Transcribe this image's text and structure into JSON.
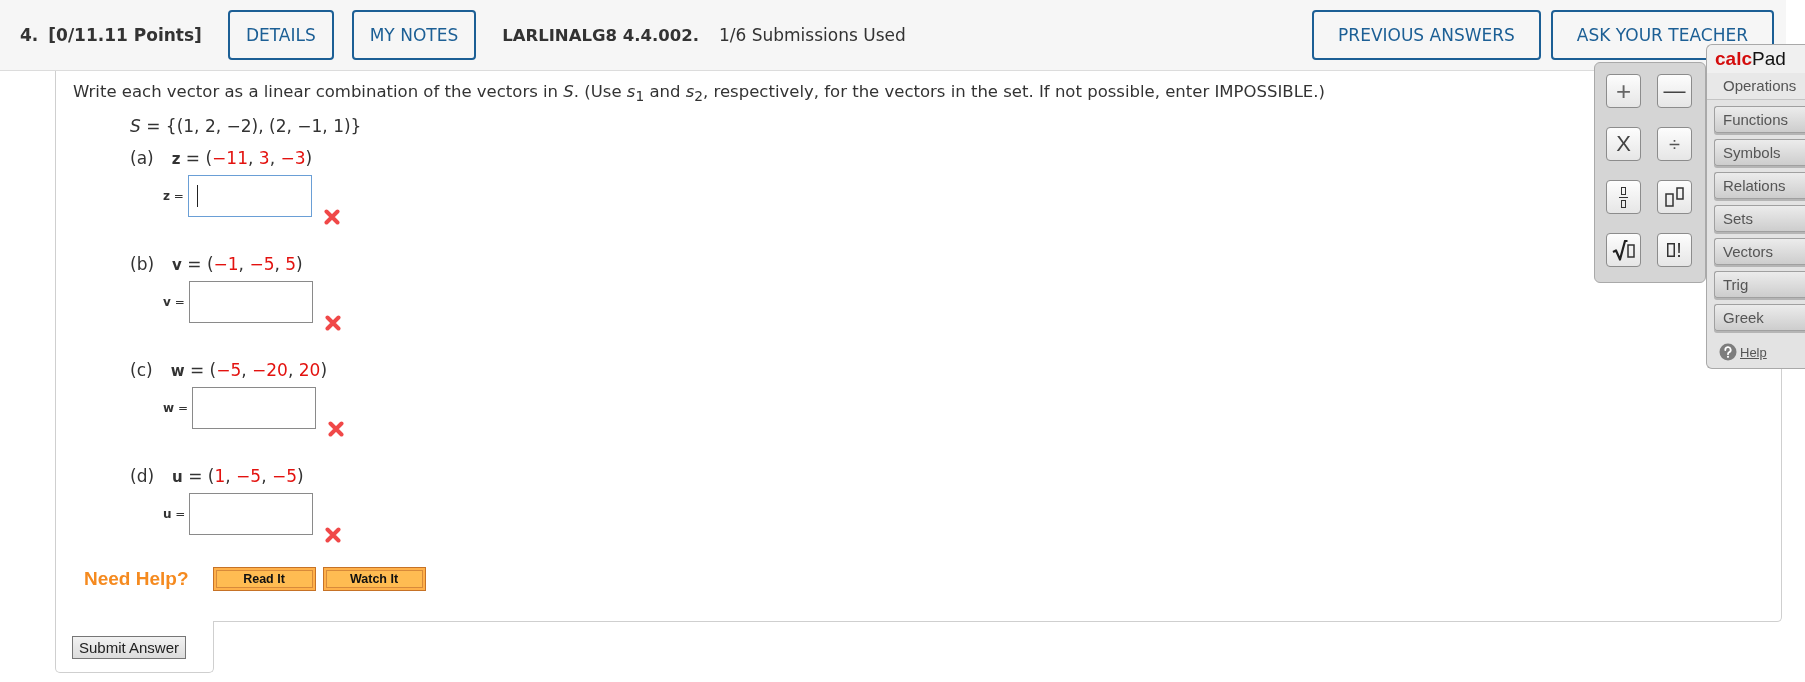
{
  "header": {
    "number": "4.",
    "points": "[0/11.11 Points]",
    "buttons_left": [
      {
        "label": "DETAILS"
      },
      {
        "label": "MY NOTES"
      }
    ],
    "code": "LARLINALG8 4.4.002.",
    "submissions": "1/6 Submissions Used",
    "buttons_right": [
      {
        "label": "PREVIOUS ANSWERS"
      },
      {
        "label": "ASK YOUR TEACHER"
      }
    ]
  },
  "question": {
    "instruction": "Write each vector as a linear combination of the vectors in *S*. (Use *s*$_{1}$ and *s*$_{2}$, respectively, for the vectors in the set. If not possible, enter IMPOSSIBLE.)",
    "set": "*S* = {(1, 2, −2), (2, −1, 1)}",
    "parts": [
      {
        "label": "(a)",
        "given": [
          {
            "kind": "name",
            "text": "z"
          },
          {
            "kind": "plain",
            "text": " = ("
          },
          {
            "kind": "value",
            "text": "−11"
          },
          {
            "kind": "plain",
            "text": ", "
          },
          {
            "kind": "value",
            "text": "3"
          },
          {
            "kind": "plain",
            "text": ", "
          },
          {
            "kind": "value",
            "text": "−3"
          },
          {
            "kind": "plain",
            "text": ")"
          }
        ],
        "answer_label": "**z** =",
        "focused": true,
        "correct": false
      },
      {
        "label": "(b)",
        "given": [
          {
            "kind": "name",
            "text": "v"
          },
          {
            "kind": "plain",
            "text": " = ("
          },
          {
            "kind": "value",
            "text": "−1"
          },
          {
            "kind": "plain",
            "text": ", "
          },
          {
            "kind": "value",
            "text": "−5"
          },
          {
            "kind": "plain",
            "text": ", "
          },
          {
            "kind": "value",
            "text": "5"
          },
          {
            "kind": "plain",
            "text": ")"
          }
        ],
        "answer_label": "**v** =",
        "focused": false,
        "correct": false
      },
      {
        "label": "(c)",
        "given": [
          {
            "kind": "name",
            "text": "w"
          },
          {
            "kind": "plain",
            "text": " = ("
          },
          {
            "kind": "value",
            "text": "−5"
          },
          {
            "kind": "plain",
            "text": ", "
          },
          {
            "kind": "value",
            "text": "−20"
          },
          {
            "kind": "plain",
            "text": ", "
          },
          {
            "kind": "value",
            "text": "20"
          },
          {
            "kind": "plain",
            "text": ")"
          }
        ],
        "answer_label": "**w** =",
        "focused": false,
        "correct": false
      },
      {
        "label": "(d)",
        "given": [
          {
            "kind": "name",
            "text": "u"
          },
          {
            "kind": "plain",
            "text": " = ("
          },
          {
            "kind": "value",
            "text": "1"
          },
          {
            "kind": "plain",
            "text": ", "
          },
          {
            "kind": "value",
            "text": "−5"
          },
          {
            "kind": "plain",
            "text": ", "
          },
          {
            "kind": "value",
            "text": "−5"
          },
          {
            "kind": "plain",
            "text": ")"
          }
        ],
        "answer_label": "**u** =",
        "focused": false,
        "correct": false
      }
    ]
  },
  "help": {
    "title": "Need Help?",
    "buttons": [
      {
        "label": "Read It"
      },
      {
        "label": "Watch It"
      }
    ]
  },
  "submit": {
    "label": "Submit Answer"
  },
  "calcpad": {
    "title": "**calc**Pad",
    "keys": [
      {
        "kind": "text",
        "label": "+"
      },
      {
        "kind": "text",
        "label": "—"
      },
      {
        "kind": "text",
        "label": "X"
      },
      {
        "kind": "text",
        "label": "÷"
      },
      {
        "kind": "fraction"
      },
      {
        "kind": "power"
      },
      {
        "kind": "sqrt"
      },
      {
        "kind": "factorial",
        "label": "!"
      }
    ],
    "menu": [
      {
        "label": "Operations",
        "selected": true
      },
      {
        "label": "Functions",
        "selected": false
      },
      {
        "label": "Symbols",
        "selected": false
      },
      {
        "label": "Relations",
        "selected": false
      },
      {
        "label": "Sets",
        "selected": false
      },
      {
        "label": "Vectors",
        "selected": false
      },
      {
        "label": "Trig",
        "selected": false
      },
      {
        "label": "Greek",
        "selected": false
      }
    ],
    "help_link": "Help"
  }
}
